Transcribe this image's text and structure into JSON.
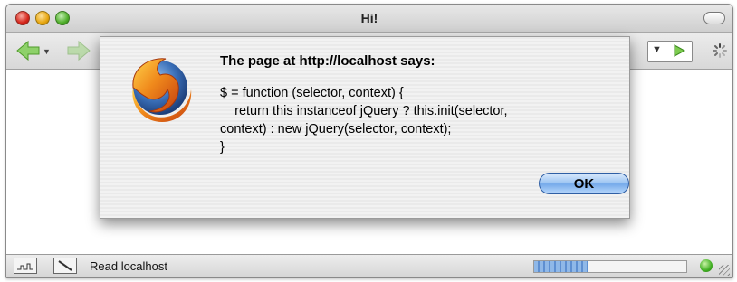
{
  "window": {
    "title": "Hi!"
  },
  "toolbar": {
    "back_icon": "back-arrow-icon",
    "forward_icon": "forward-arrow-icon",
    "go_icon": "go-arrow-icon",
    "throbber_icon": "loading-spinner-icon"
  },
  "dialog": {
    "heading": "The page at http://localhost says:",
    "message": "$ = function (selector, context) {\n    return this instanceof jQuery ? this.init(selector,\ncontext) : new jQuery(selector, context);\n}",
    "ok_label": "OK",
    "icon": "firefox-logo-icon"
  },
  "statusbar": {
    "text": "Read localhost",
    "progress_percent": 35,
    "status_icon": "status-ok-icon"
  },
  "colors": {
    "ok_button": "#9cc4f2",
    "progress": "#5e8fd1",
    "status_ok": "#3fae21"
  }
}
